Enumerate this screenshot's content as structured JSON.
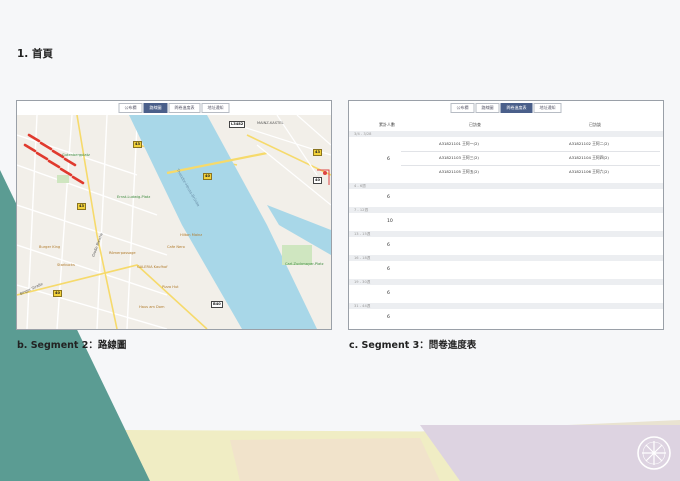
{
  "slide": {
    "title": "1. 首頁"
  },
  "tabs": [
    "公布欄",
    "路線圖",
    "問卷進度表",
    "地址通知"
  ],
  "map_panel": {
    "active_tab_index": 1,
    "caption": "b. Segment 2：路線圖",
    "labels": {
      "district": "MAINZ-KASTEL",
      "river": "Rhein",
      "bridge": "Theodor-Heuss-Brücke",
      "square_1": "Gutenbergplatz",
      "square_2": "Ernst-Ludwig-Platz",
      "hotel": "Hilton Mainz",
      "square_3": "Carl-Zuckmayer-Platz",
      "street_1": "Große Bleiche",
      "street_2": "Binger Straße",
      "mall": "Römerpassage",
      "store": "GALERIA Kaufhof",
      "cafe": "Cafe Nero",
      "gym": "Hilton Mainz",
      "shop_1": "Starbucks",
      "shop_2": "Burger King",
      "restaurant": "Pizza Hut",
      "landmark": "Haus am Dom"
    },
    "road_shields": [
      "L3482",
      "43",
      "43",
      "40",
      "43",
      "40",
      "40",
      "B40"
    ]
  },
  "table_panel": {
    "active_tab_index": 2,
    "caption": "c. Segment 3：問卷進度表",
    "headers": {
      "count": "累計人數",
      "done": "已訪查",
      "pending": "已訪談"
    },
    "groups": [
      {
        "label": "3/4 - 3/28",
        "count": "6",
        "rows": [
          {
            "done": "A31821101 王阿一(2)",
            "pending": "A31821102 王阿二(2)"
          },
          {
            "done": "A31821103 王阿三(2)",
            "pending": "A31821104 王阿四(2)"
          },
          {
            "done": "A31821105 王阿五(2)",
            "pending": "A31821106 王阿六(2)"
          }
        ]
      },
      {
        "label": "4 - 6週",
        "count": "6",
        "rows": []
      },
      {
        "label": "7 - 12週",
        "count": "10",
        "rows": []
      },
      {
        "label": "13 - 15週",
        "count": "6",
        "rows": []
      },
      {
        "label": "16 - 18週",
        "count": "6",
        "rows": []
      },
      {
        "label": "19 - 30週",
        "count": "6",
        "rows": []
      },
      {
        "label": "31 - 44週",
        "count": "6",
        "rows": []
      }
    ]
  },
  "colors": {
    "teal": "#5b9c93",
    "active_tab": "#4a5f8a",
    "river": "#a8d7e8",
    "route": "#e03a2e"
  }
}
